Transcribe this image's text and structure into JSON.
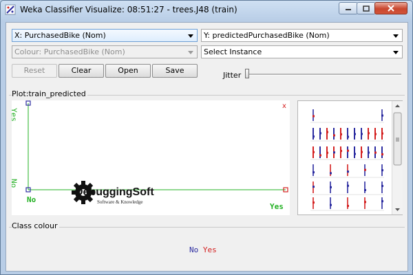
{
  "window": {
    "title": "Weka Classifier Visualize: 08:51:27 - trees.J48 (train)"
  },
  "controls": {
    "x_axis": "X: PurchasedBike (Nom)",
    "y_axis": "Y: predictedPurchasedBike (Nom)",
    "colour": "Colour: PurchasedBike (Nom)",
    "select_instance": "Select Instance",
    "reset_label": "Reset",
    "clear_label": "Clear",
    "open_label": "Open",
    "save_label": "Save",
    "jitter_label": "Jitter",
    "jitter_value": 0
  },
  "plot": {
    "title": "Plot:train_predicted",
    "y_top_label": "Yes",
    "y_bottom_label": "No",
    "x_left_label": "No",
    "x_right_label": "Yes",
    "close_mark": "x",
    "watermark_title": "DebuggingSoft",
    "watermark_subtitle": "Software & Knowledge",
    "colors": {
      "axis": "#22b022",
      "yes": "#d42020",
      "no": "#2b2ba0"
    }
  },
  "chart_data": {
    "type": "scatter",
    "xlabel": "PurchasedBike",
    "ylabel": "predictedPurchasedBike",
    "x_categories": [
      "No",
      "Yes"
    ],
    "y_categories": [
      "No",
      "Yes"
    ],
    "points": [
      {
        "x": "No",
        "y": "No",
        "class": "No"
      },
      {
        "x": "No",
        "y": "Yes",
        "class": "No"
      },
      {
        "x": "Yes",
        "y": "No",
        "class": "Yes"
      }
    ]
  },
  "class_colour": {
    "title": "Class colour",
    "items": [
      {
        "label": "No",
        "color": "#2b2ba0"
      },
      {
        "label": "Yes",
        "color": "#d42020"
      }
    ]
  }
}
